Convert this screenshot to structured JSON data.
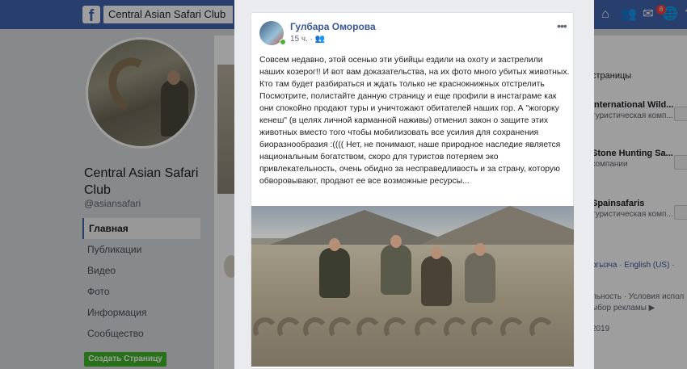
{
  "topbar": {
    "logo": "f",
    "search_value": "Central Asian Safari Club",
    "notification_count": "8",
    "icons": [
      "home-icon",
      "friends-icon",
      "messenger-icon",
      "notifications-icon",
      "help-icon"
    ]
  },
  "page": {
    "name": "Central Asian Safari Club",
    "handle": "@asiansafari",
    "nav": [
      "Главная",
      "Публикации",
      "Видео",
      "Фото",
      "Информация",
      "Сообщество"
    ],
    "create_button": "Создать Страницу"
  },
  "right": {
    "title": "страницы",
    "suggestions": [
      {
        "name": "International Wild...",
        "category": "туристическая комп..."
      },
      {
        "name": "Stone Hunting Sa...",
        "category": "компании"
      },
      {
        "name": "Spainsafaris",
        "category": "туристическая комп..."
      }
    ],
    "langs": "ргызча · English (US) ·",
    "footer1": "льность · Условия испол",
    "footer2": "ыбор рекламы ▶",
    "footer3": "2019"
  },
  "post": {
    "author": "Гулбара Оморова",
    "time": "15 ч.",
    "audience_icon": "friends-icon",
    "more_icon": "more-icon",
    "paragraph1": "Совсем недавно, этой осенью эти убийцы ездили на охоту и застрелили наших козерог!! И вот вам доказательства, на их фото много убитых животных. Кто там будет разбираться и ждать только не краснокнижных отстрелить",
    "paragraph2": "Посмотрите, полистайте данную страницу и еще профили в инстаграме как они спокойно продают туры и уничтожают обитателей наших гор. А \"жогорку кенеш\" (в целях личной карманной наживы) отменил закон о защите этих животных вместо того чтобы мобилизовать все усилия для сохранения биоразнообразия :(((( Нет, не понимают, наше природное наследие является национальным богатством, скоро для туристов потеряем эко привлекательность, очень обидно за несправедливость и за страну, которую обворовывают, продают ее все возможные ресурсы..."
  },
  "colors": {
    "topbar": "#4267b2",
    "link": "#385898",
    "create_button": "#42b72a",
    "badge": "#fa3e3e"
  }
}
